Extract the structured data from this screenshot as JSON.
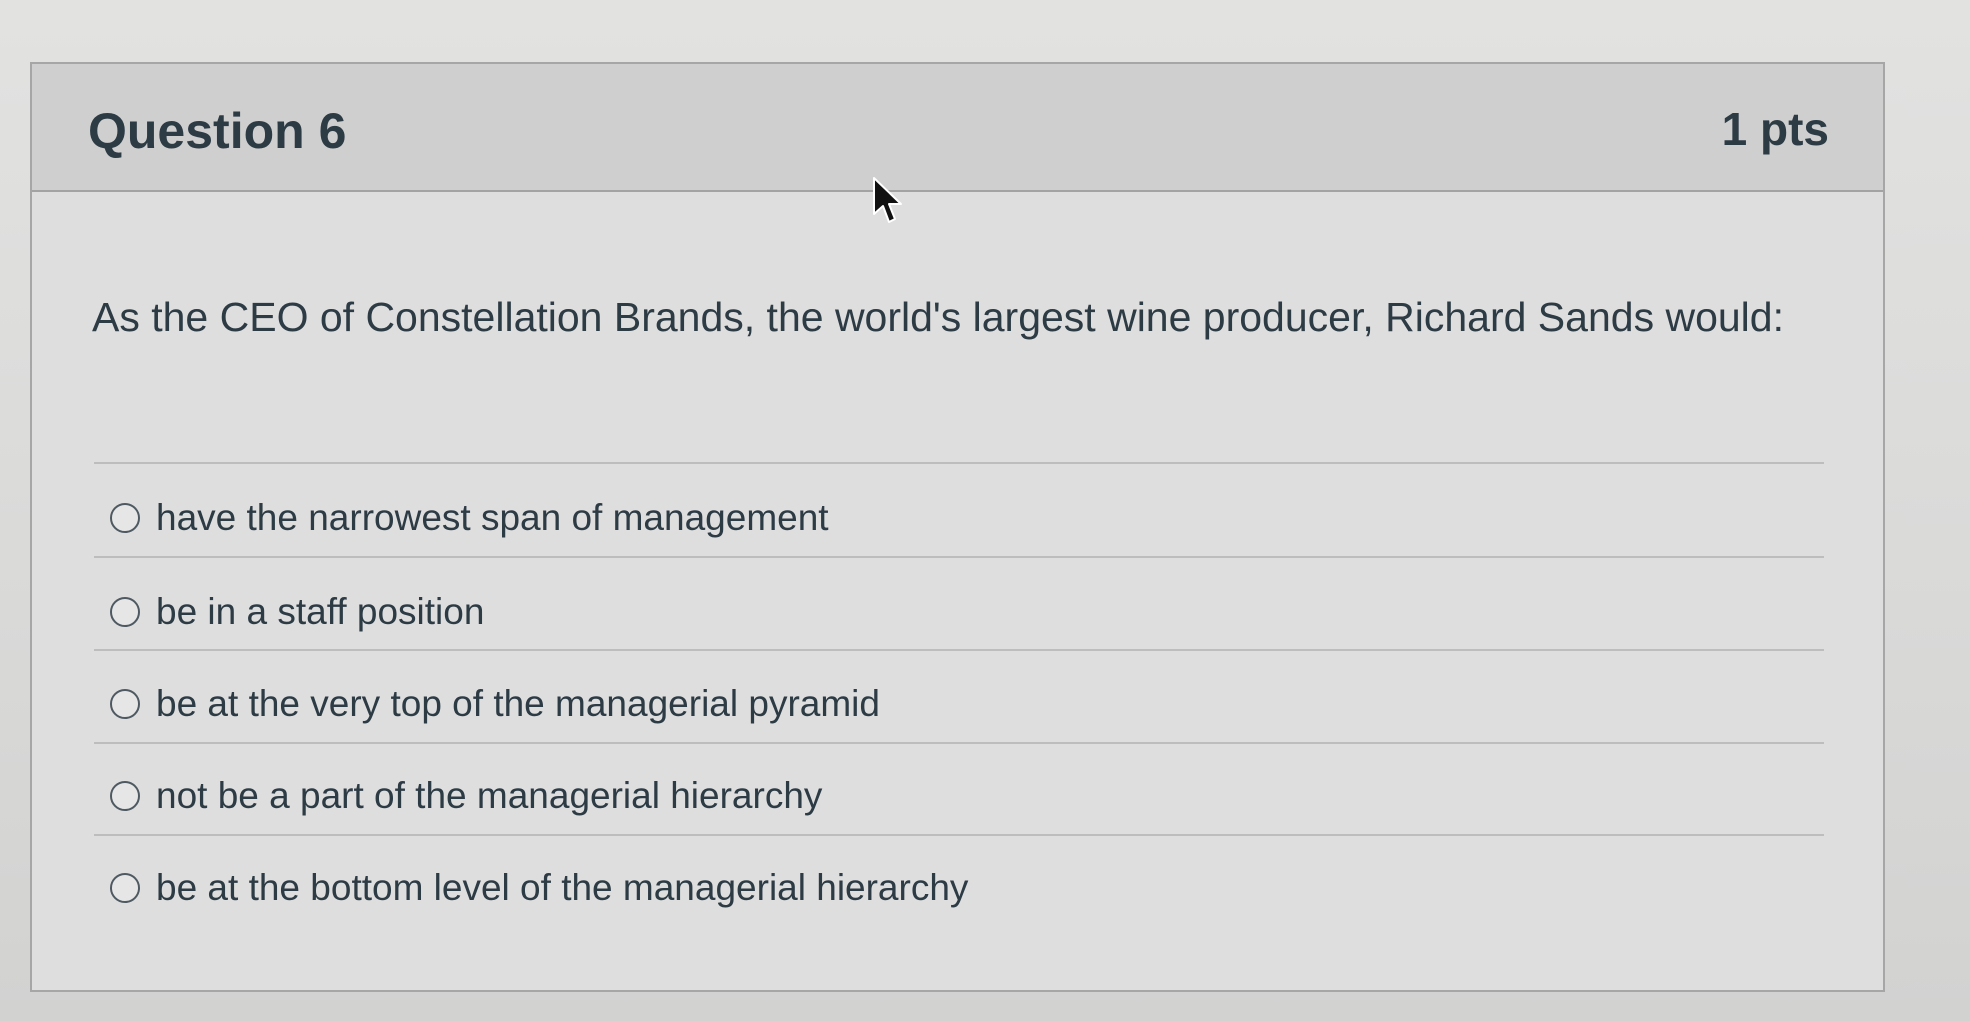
{
  "question": {
    "title": "Question 6",
    "points": "1 pts",
    "text": "As the CEO of Constellation Brands, the world's largest wine producer, Richard Sands would:",
    "answers": [
      {
        "label": "have the narrowest span of management",
        "selected": false
      },
      {
        "label": "be in a staff position",
        "selected": false
      },
      {
        "label": "be at the very top of the managerial pyramid",
        "selected": false
      },
      {
        "label": "not be a part of the managerial hierarchy",
        "selected": false
      },
      {
        "label": "be at the bottom level of the managerial hierarchy",
        "selected": false
      }
    ]
  },
  "icons": {
    "cursor": "mouse-pointer-icon",
    "radio": "radio-button-icon"
  },
  "colors": {
    "text": "#2d3b45",
    "header_bg": "#cfcfcf",
    "border": "#a6a6a6"
  }
}
